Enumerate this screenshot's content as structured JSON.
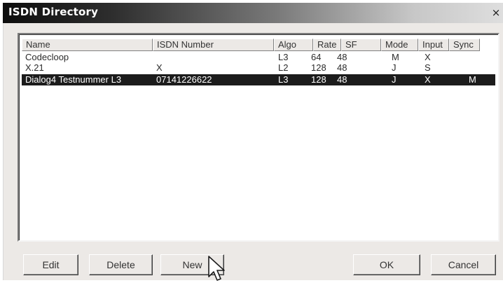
{
  "window": {
    "title": "ISDN Directory",
    "close_glyph": "×"
  },
  "list": {
    "columns": [
      "Name",
      "ISDN Number",
      "Algo",
      "Rate",
      "SF",
      "Mode",
      "Input",
      "Sync"
    ],
    "rows": [
      {
        "name": "Codecloop",
        "number": "",
        "algo": "L3",
        "rate": "64",
        "sf": "48",
        "mode": "M",
        "input": "X",
        "sync": "",
        "selected": false
      },
      {
        "name": "X.21",
        "number": "X",
        "algo": "L2",
        "rate": "128",
        "sf": "48",
        "mode": "J",
        "input": "S",
        "sync": "",
        "selected": false
      },
      {
        "name": "Dialog4 Testnummer L3",
        "number": "07141226622",
        "algo": "L3",
        "rate": "128",
        "sf": "48",
        "mode": "J",
        "input": "X",
        "sync": "M",
        "selected": true
      }
    ]
  },
  "buttons": {
    "edit": "Edit",
    "delete": "Delete",
    "new": "New",
    "ok": "OK",
    "cancel": "Cancel"
  },
  "icons": {
    "cursor": "arrow-cursor-icon"
  }
}
